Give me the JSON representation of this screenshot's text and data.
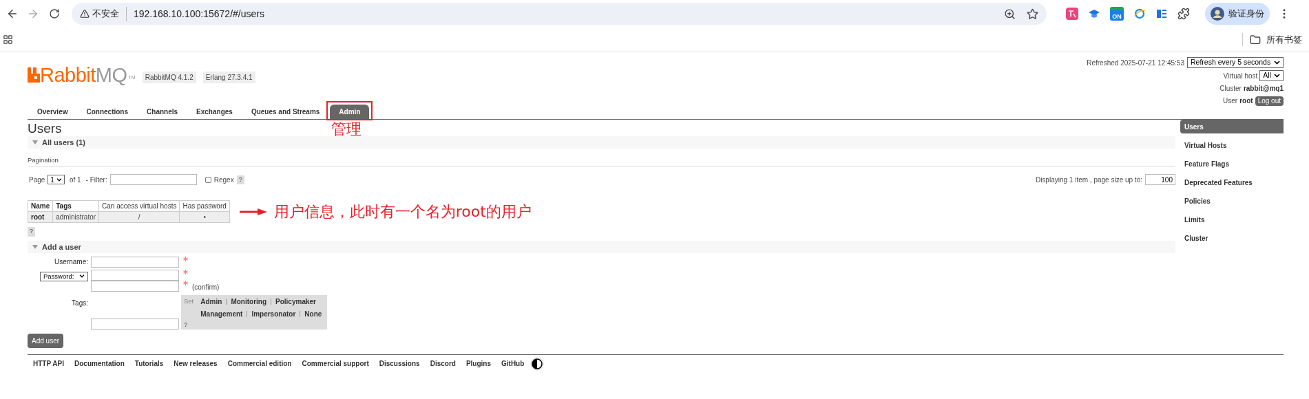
{
  "browser": {
    "security_label": "不安全",
    "url": "192.168.10.100:15672/#/users",
    "extension_badge": "ON",
    "profile_label": "验证身份",
    "bookmarks_label": "所有书签"
  },
  "header": {
    "logo_brand": "Rabbit",
    "logo_suffix": "MQ",
    "logo_tm": "TM",
    "version_badges": [
      "RabbitMQ 4.1.2",
      "Erlang 27.3.4.1"
    ],
    "refreshed": "Refreshed 2025-07-21 12:45:53",
    "refresh_select": "Refresh every 5 seconds",
    "vhost_label": "Virtual host",
    "vhost_select": "All",
    "cluster_label": "Cluster",
    "cluster_name": "rabbit@mq1",
    "user_label": "User",
    "user_name": "root",
    "logout": "Log out"
  },
  "tabs": [
    {
      "label": "Overview",
      "selected": false
    },
    {
      "label": "Connections",
      "selected": false
    },
    {
      "label": "Channels",
      "selected": false
    },
    {
      "label": "Exchanges",
      "selected": false
    },
    {
      "label": "Queues and Streams",
      "selected": false
    },
    {
      "label": "Admin",
      "selected": true
    }
  ],
  "annotations": {
    "tab_note": "管理",
    "table_note": "用户信息，此时有一个名为root的用户"
  },
  "page_title": "Users",
  "users_section": {
    "title": "All users (1)",
    "expanded": true
  },
  "pagination": {
    "title": "Pagination",
    "page_label": "Page",
    "page_select": "1",
    "of_label": "of 1",
    "filter_label": "- Filter:",
    "regex_label": "Regex",
    "regex_checked": false,
    "help": "?",
    "displaying": "Displaying 1 item , page size up to:",
    "page_size": "100"
  },
  "table": {
    "columns": [
      "Name",
      "Tags",
      "Can access virtual hosts",
      "Has password"
    ],
    "rows": [
      [
        "root",
        "administrator",
        "/",
        "•"
      ]
    ]
  },
  "table_help": "?",
  "add_section": {
    "title": "Add a user",
    "expanded": true
  },
  "form": {
    "username_label": "Username:",
    "password_select": "Password:",
    "confirm_label": "(confirm)",
    "tags_label": "Tags:",
    "tags_set_label": "Set",
    "tag_rows": [
      [
        "Admin",
        "Monitoring",
        "Policymaker"
      ],
      [
        "Management",
        "Impersonator",
        "None"
      ]
    ],
    "tags_help": "?",
    "submit": "Add user"
  },
  "sidebar": [
    {
      "label": "Users",
      "selected": true
    },
    {
      "label": "Virtual Hosts",
      "selected": false
    },
    {
      "label": "Feature Flags",
      "selected": false
    },
    {
      "label": "Deprecated Features",
      "selected": false
    },
    {
      "label": "Policies",
      "selected": false
    },
    {
      "label": "Limits",
      "selected": false
    },
    {
      "label": "Cluster",
      "selected": false
    }
  ],
  "footer_links": [
    "HTTP API",
    "Documentation",
    "Tutorials",
    "New releases",
    "Commercial edition",
    "Commercial support",
    "Discussions",
    "Discord",
    "Plugins",
    "GitHub"
  ]
}
